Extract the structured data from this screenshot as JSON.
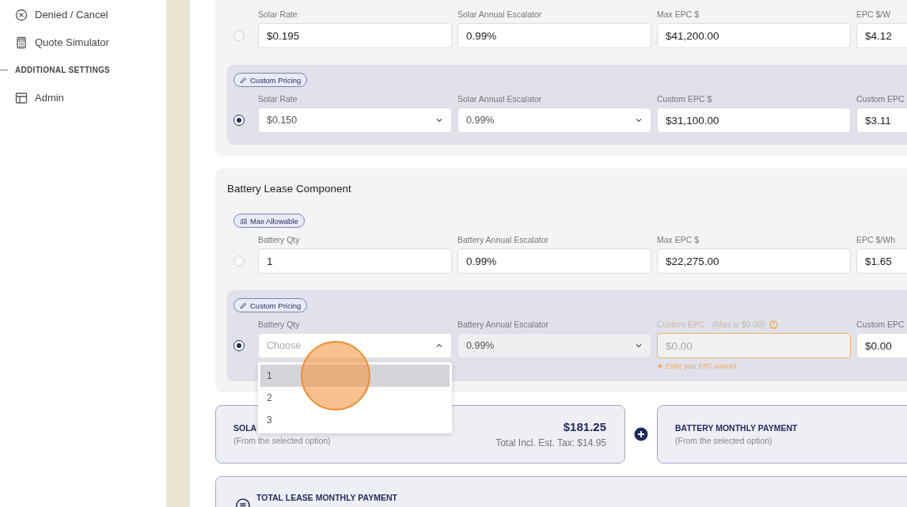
{
  "sidebar": [
    {
      "kind": "item",
      "label": "Denied / Cancel",
      "selected": false
    },
    {
      "kind": "item",
      "label": "Quote Simulator",
      "selected": false
    },
    {
      "kind": "heading",
      "label": "ADDITIONAL SETTINGS"
    },
    {
      "kind": "item",
      "label": "Admin",
      "selected": false
    }
  ],
  "solar": {
    "options": [
      {
        "kind": "max",
        "selected": false,
        "fields": [
          {
            "kind": "input",
            "label": "Solar Rate",
            "value": "$0.195"
          },
          {
            "kind": "input",
            "label": "Solar Annual Escalator",
            "value": "0.99%"
          },
          {
            "kind": "input",
            "label": "Max EPC $",
            "value": "$41,200.00"
          },
          {
            "kind": "input",
            "label": "EPC $/W",
            "value": "$4.12"
          }
        ]
      },
      {
        "kind": "custom",
        "badge": "Custom Pricing",
        "selected": true,
        "fields": [
          {
            "kind": "select",
            "label": "Solar Rate",
            "value": "$0.150"
          },
          {
            "kind": "select",
            "label": "Solar Annual Escalator",
            "value": "0.99%"
          },
          {
            "kind": "input",
            "label": "Custom EPC $",
            "value": "$31,100.00"
          },
          {
            "kind": "input",
            "label": "Custom EPC",
            "value": "$3.11"
          }
        ]
      }
    ]
  },
  "battery": {
    "title": "Battery Lease Component",
    "options": [
      {
        "kind": "max",
        "badge": "Max Allowable",
        "selected": false,
        "fields": [
          {
            "kind": "input",
            "label": "Battery Qty",
            "value": "1"
          },
          {
            "kind": "input",
            "label": "Battery Annual Escalator",
            "value": "0.99%"
          },
          {
            "kind": "input",
            "label": "Max EPC $",
            "value": "$22,275.00"
          },
          {
            "kind": "input",
            "label": "EPC $/Wh",
            "value": "$1.65"
          }
        ]
      },
      {
        "kind": "custom",
        "badge": "Custom Pricing",
        "selected": true,
        "fields": [
          {
            "kind": "select",
            "label": "Battery Qty",
            "placeholder": "Choose",
            "expanded": true,
            "options": [
              {
                "label": "1",
                "selected": true
              },
              {
                "label": "2",
                "selected": false
              },
              {
                "label": "3",
                "selected": false
              }
            ]
          },
          {
            "kind": "select",
            "label": "Battery Annual Escalator",
            "value": "0.99%",
            "disabled": true
          },
          {
            "kind": "input",
            "label": "Custom EPC - (Max is $0.00)",
            "placeholder": "$0.00",
            "error": true,
            "hint": "Enter your EPC amount."
          },
          {
            "kind": "input",
            "label": "Custom EPC",
            "value": "$0.00"
          }
        ]
      }
    ]
  },
  "summary": [
    {
      "kind": "solar",
      "title": "SOLA",
      "subtitle": "(From the selected option)",
      "amount": "$181.25",
      "tax": "Total Incl. Est. Tax: $14.95"
    },
    {
      "kind": "battery",
      "title": "BATTERY MONTHLY PAYMENT",
      "subtitle": "(From the selected option)"
    }
  ],
  "total": {
    "title": "TOTAL LEASE MONTHLY PAYMENT"
  }
}
